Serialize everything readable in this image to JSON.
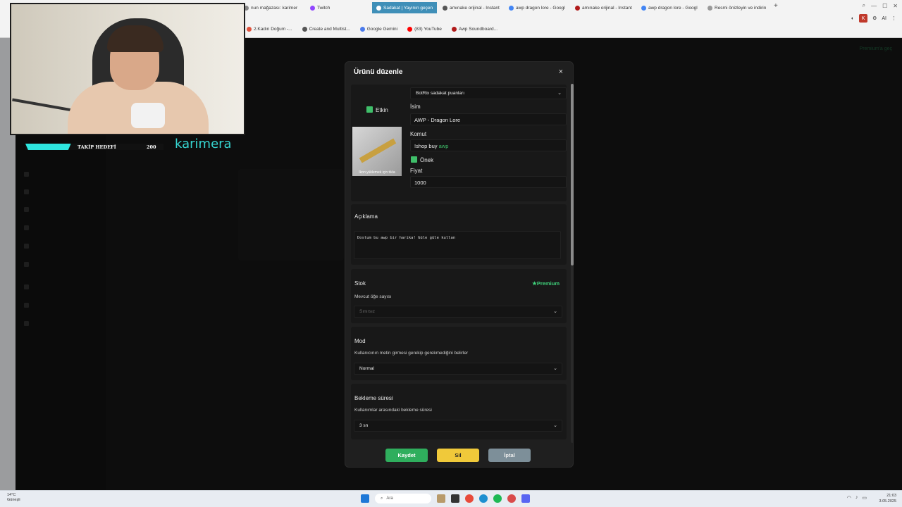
{
  "browser": {
    "tabs": [
      {
        "label": "nun mağazası: karimer",
        "color": "#888888",
        "active": false
      },
      {
        "label": "Twitch",
        "color": "#9146ff",
        "active": false
      },
      {
        "label": "Sadakat | Yayının geçen",
        "color": "#ffffff",
        "active": true
      },
      {
        "label": "amınake orijinal - Instant",
        "color": "#555555",
        "active": false
      },
      {
        "label": "awp dragon lore - Googl",
        "color": "#4285f4",
        "active": false
      },
      {
        "label": "amınake orijinal - Instant",
        "color": "#b01a1a",
        "active": false
      },
      {
        "label": "awp dragon lore - Googl",
        "color": "#4285f4",
        "active": false
      },
      {
        "label": "Resmi önizleyin ve indirin",
        "color": "#999999",
        "active": false
      }
    ],
    "new_tab": "+",
    "ai_label": "AI",
    "bookmarks": [
      {
        "label": "2.Kadın Doğum -...",
        "color": "#e0533d"
      },
      {
        "label": "Create and Multist...",
        "color": "#555555"
      },
      {
        "label": "Google Gemini",
        "color": "#4b7bec"
      },
      {
        "label": "(83) YouTube",
        "color": "#ff0000"
      },
      {
        "label": "Awp Soundboard...",
        "color": "#b01a1a"
      }
    ]
  },
  "page": {
    "premium_link": "Premium'a geç"
  },
  "overlay": {
    "goal_label": "TAKİP HEDEFİ",
    "goal_value": "200",
    "goal_progress": 0.33,
    "brand": "karimera"
  },
  "modal": {
    "title": "Ürünü düzenle",
    "close": "×",
    "reward_source": "BotRix sadakat puanları",
    "enabled_label": "Etkin",
    "name_label": "İsim",
    "name_value": "AWP - Dragon Lore",
    "command_label": "Komut",
    "command_prefix": "!shop buy ",
    "command_suffix": "awp",
    "prefix_label": "Önek",
    "price_label": "Fiyat",
    "price_value": "1000",
    "thumb_caption": "İkon yüklemek için tıkla",
    "description_label": "Açıklama",
    "description_value": "Dostum bu awp bir harika! Güle güle kullan",
    "stock_label": "Stok",
    "premium_badge": "Premium",
    "stock_sub": "Mevcut öğe sayısı",
    "stock_value": "Sınırsız",
    "mode_label": "Mod",
    "mode_sub": "Kullanıcının metin girmesi gerekip gerekmediğini belirler",
    "mode_value": "Normal",
    "cooldown_label": "Bekleme süresi",
    "cooldown_sub": "Kullanımlar arasındaki bekleme süresi",
    "cooldown_value": "3 sn",
    "save": "Kaydet",
    "delete": "Sil",
    "cancel": "İptal"
  },
  "taskbar": {
    "temp": "14°C",
    "weather": "Güneşli",
    "search": "Ara",
    "time": "21:03",
    "date": "3.05.2025"
  },
  "colors": {
    "accent": "#2fae5d",
    "teal": "#2ee6e0",
    "warning": "#f0c93a"
  }
}
